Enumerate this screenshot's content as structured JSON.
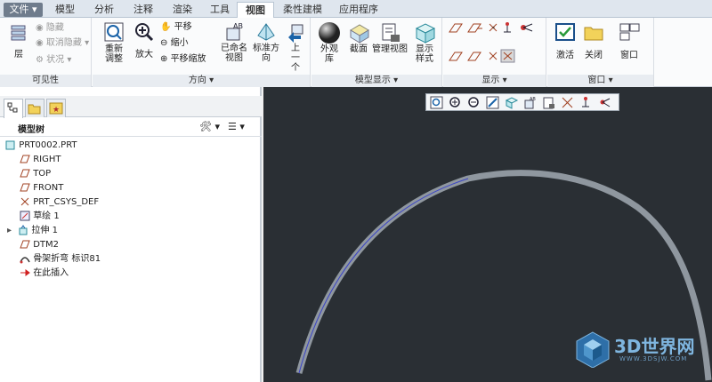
{
  "tabs": [
    "文件",
    "模型",
    "分析",
    "注释",
    "渲染",
    "工具",
    "视图",
    "柔性建模",
    "应用程序"
  ],
  "groups": {
    "visibility": {
      "label": "可见性",
      "layer": "层",
      "hide": "隐藏",
      "unhide": "取消隐藏",
      "status": "状况"
    },
    "orientation": {
      "label": "方向",
      "refit": "重新调整",
      "zoom_in": "放大",
      "pan": "平移",
      "zoom_out": "缩小",
      "pan_zoom": "平移缩放",
      "named_views": "已命名视图",
      "standard_orient": "标准方向",
      "previous": "上一个"
    },
    "model_display": {
      "label": "模型显示",
      "appearance": "外观库",
      "section": "截面",
      "manage_views": "管理视图",
      "display_style": "显示样式"
    },
    "show": {
      "label": "显示"
    },
    "window": {
      "label": "窗口",
      "activate": "激活",
      "close": "关闭",
      "window": "窗口"
    }
  },
  "tree": {
    "title": "模型树",
    "items": [
      {
        "label": "PRT0002.PRT",
        "icon": "part-icon"
      },
      {
        "label": "RIGHT",
        "icon": "datum-plane-icon"
      },
      {
        "label": "TOP",
        "icon": "datum-plane-icon"
      },
      {
        "label": "FRONT",
        "icon": "datum-plane-icon"
      },
      {
        "label": "PRT_CSYS_DEF",
        "icon": "csys-icon"
      },
      {
        "label": "草绘 1",
        "icon": "sketch-icon"
      },
      {
        "label": "拉伸 1",
        "icon": "extrude-icon"
      },
      {
        "label": "DTM2",
        "icon": "datum-plane-icon"
      },
      {
        "label": "骨架折弯 标识81",
        "icon": "spinal-bend-icon"
      },
      {
        "label": "在此插入",
        "icon": "insert-here-icon"
      }
    ]
  },
  "watermark": {
    "brand": "3D世界网",
    "url": "WWW.3DSJW.COM"
  },
  "colors": {
    "file_tab": "#6f7c8c",
    "viewport_bg": "#2a2f34",
    "arc": "#9aa1a8"
  }
}
